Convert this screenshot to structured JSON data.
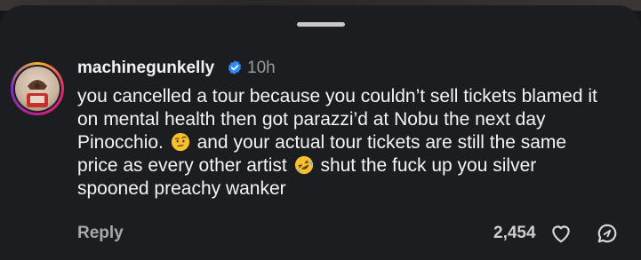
{
  "comment": {
    "username": "machinegunkelly",
    "timestamp": "10h",
    "text_part1": "you cancelled a tour because you couldn’t sell tickets blamed it on mental health then got parazzi’d at Nobu the next day Pinocchio.",
    "emoji1": "face-with-raised-eyebrow-emoji",
    "text_part2": "and your actual tour tickets are still the same price as every other artist",
    "emoji2": "rolling-on-the-floor-laughing-emoji",
    "text_part3": "shut the fuck up you silver spooned preachy wanker",
    "reply_label": "Reply",
    "like_count": "2,454"
  },
  "icons": {
    "verified": "verified-badge-icon",
    "like": "heart-icon",
    "share": "share-icon"
  },
  "colors": {
    "background": "#1c1d20",
    "verified_blue": "#2f8cf5",
    "text": "#f4f4f4",
    "muted": "#9a9a9e"
  }
}
